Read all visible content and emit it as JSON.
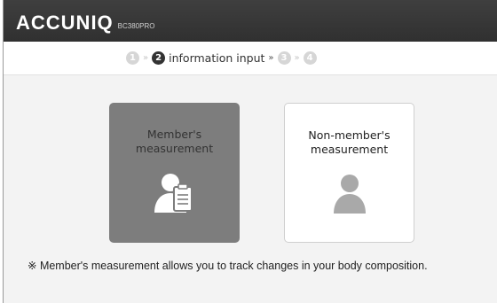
{
  "header": {
    "brand": "ACCUNIQ",
    "model": "BC380PRO"
  },
  "steps": {
    "step1": "1",
    "sep1": "»",
    "step2": "2",
    "step2_label": "information input",
    "sep2": "»",
    "step3": "3",
    "sep3": "»",
    "step4": "4"
  },
  "cards": {
    "member": {
      "line1": "Member's",
      "line2": "measurement",
      "icon": "member-clipboard-icon"
    },
    "nonmember": {
      "line1": "Non-member's",
      "line2": "measurement",
      "icon": "person-icon"
    }
  },
  "note": "※ Member's measurement allows you to track changes in your body composition.",
  "colors": {
    "topbar": "#333333",
    "selected_card": "#7d7d7d",
    "active_step": "#333333",
    "inactive_step": "#d6d6d6"
  }
}
